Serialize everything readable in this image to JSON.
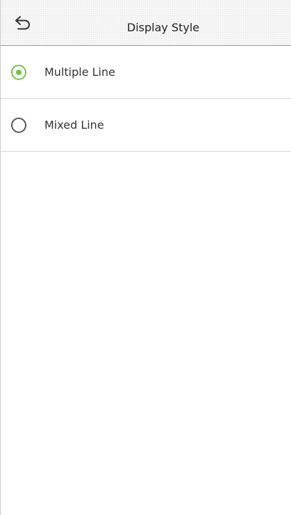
{
  "header": {
    "back_icon": "back-arrow-icon",
    "title": "Display Style"
  },
  "options": [
    {
      "label": "Multiple Line",
      "selected": true
    },
    {
      "label": "Mixed Line",
      "selected": false
    }
  ],
  "colors": {
    "accent": "#77c44a",
    "divider": "#d8d8d8",
    "text": "#333333"
  }
}
